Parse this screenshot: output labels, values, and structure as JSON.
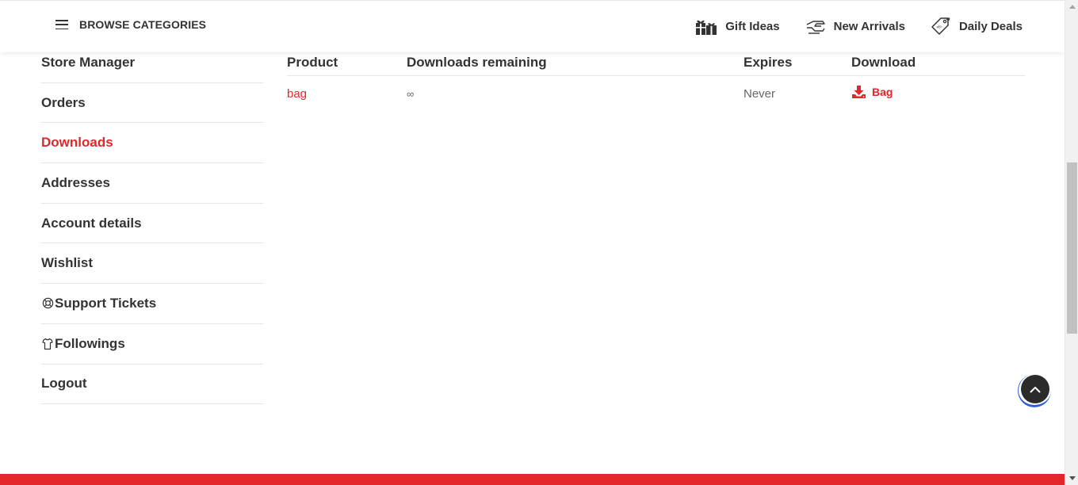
{
  "header": {
    "browse_label": "BROWSE CATEGORIES",
    "links": [
      {
        "label": "Gift Ideas",
        "icon": "gift-icon"
      },
      {
        "label": "New Arrivals",
        "icon": "new-arrivals-icon"
      },
      {
        "label": "Daily Deals",
        "icon": "price-tag-icon"
      }
    ]
  },
  "sidebar": {
    "items": [
      {
        "label": "Store Manager",
        "active": false
      },
      {
        "label": "Orders",
        "active": false
      },
      {
        "label": "Downloads",
        "active": true
      },
      {
        "label": "Addresses",
        "active": false
      },
      {
        "label": "Account details",
        "active": false
      },
      {
        "label": "Wishlist",
        "active": false
      },
      {
        "label": "Support Tickets",
        "active": false,
        "icon": "lifebuoy-icon"
      },
      {
        "label": "Followings",
        "active": false,
        "icon": "shirt-icon"
      },
      {
        "label": "Logout",
        "active": false
      }
    ]
  },
  "downloads": {
    "columns": [
      "Product",
      "Downloads remaining",
      "Expires",
      "Download"
    ],
    "rows": [
      {
        "product": "bag",
        "remaining": "∞",
        "expires": "Never",
        "download_label": "Bag"
      }
    ]
  },
  "colors": {
    "accent": "#e3262a",
    "text": "#333333",
    "muted": "#666666",
    "divider": "#e6e6e6",
    "to_top_bg": "#2b2b2b",
    "to_top_ring": "#2f5fd8"
  },
  "controls": {
    "back_to_top_icon": "chevron-up-icon"
  }
}
